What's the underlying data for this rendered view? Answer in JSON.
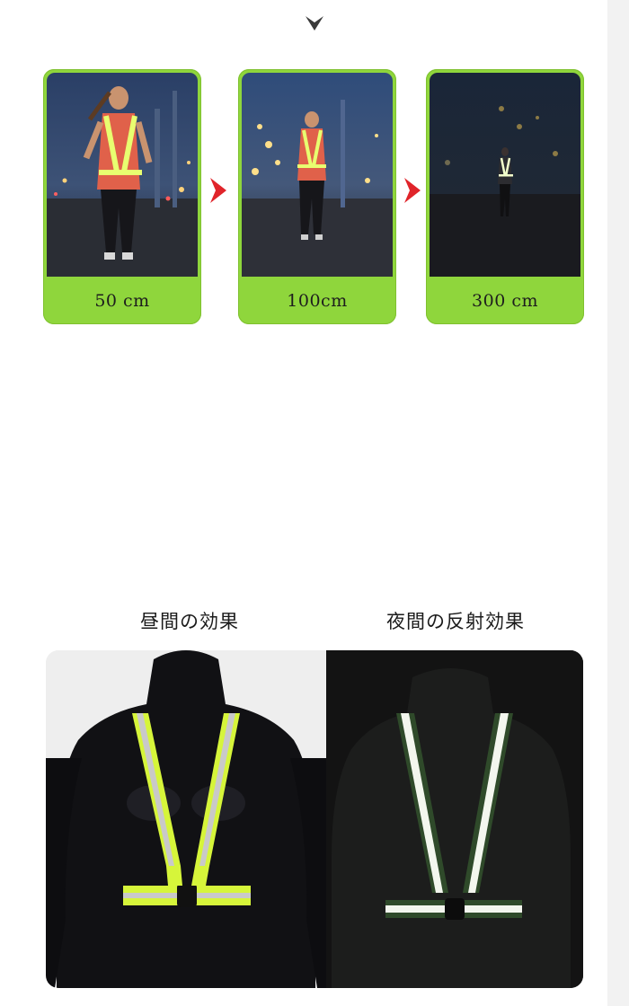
{
  "distance_cards": [
    {
      "label": "50 cm"
    },
    {
      "label": "100cm"
    },
    {
      "label": "300 cm"
    }
  ],
  "comparison": {
    "day_title": "昼間の効果",
    "night_title": "夜間の反射効果"
  },
  "colors": {
    "accent_green": "#8fd63c",
    "arrow_red": "#e0242a"
  },
  "icons": {
    "top": "chevron-down-icon",
    "between_cards": "chevron-right-icon"
  }
}
